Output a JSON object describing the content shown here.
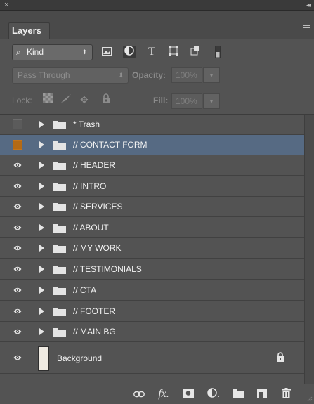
{
  "panel": {
    "tab_label": "Layers",
    "close_glyph": "×",
    "collapse_glyph": "◂◂"
  },
  "filter": {
    "kind_label": "Kind",
    "kind_icon": "search-icon",
    "icons": [
      "pixel-filter-icon",
      "adjustment-filter-icon",
      "type-filter-icon",
      "shape-filter-icon",
      "smart-object-filter-icon",
      "filter-toggle-icon"
    ]
  },
  "blend": {
    "mode": "Pass Through",
    "opacity_label": "Opacity:",
    "opacity_value": "100%"
  },
  "lock": {
    "label": "Lock:",
    "fill_label": "Fill:",
    "fill_value": "100%"
  },
  "layers": [
    {
      "name": "* Trash",
      "type": "group",
      "visible": false,
      "selected": false,
      "color_tag": "none"
    },
    {
      "name": "// CONTACT FORM",
      "type": "group",
      "visible": false,
      "selected": true,
      "color_tag": "orange"
    },
    {
      "name": "// HEADER",
      "type": "group",
      "visible": true,
      "selected": false
    },
    {
      "name": "// INTRO",
      "type": "group",
      "visible": true,
      "selected": false
    },
    {
      "name": "// SERVICES",
      "type": "group",
      "visible": true,
      "selected": false
    },
    {
      "name": "// ABOUT",
      "type": "group",
      "visible": true,
      "selected": false
    },
    {
      "name": "// MY WORK",
      "type": "group",
      "visible": true,
      "selected": false
    },
    {
      "name": "// TESTIMONIALS",
      "type": "group",
      "visible": true,
      "selected": false
    },
    {
      "name": "// CTA",
      "type": "group",
      "visible": true,
      "selected": false
    },
    {
      "name": "// FOOTER",
      "type": "group",
      "visible": true,
      "selected": false
    },
    {
      "name": "// MAIN BG",
      "type": "group",
      "visible": true,
      "selected": false
    }
  ],
  "background_layer": {
    "name": "Background",
    "visible": true,
    "locked": true
  },
  "footer_icons": [
    "link-layers-icon",
    "fx-icon",
    "add-mask-icon",
    "new-adjustment-icon",
    "new-group-icon",
    "new-layer-icon",
    "delete-layer-icon"
  ],
  "colors": {
    "selected_row": "#566a83",
    "orange_tag": "#b46a14",
    "panel_bg": "#535353"
  }
}
